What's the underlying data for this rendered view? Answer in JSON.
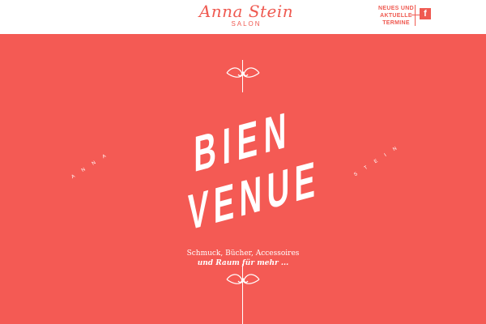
{
  "header": {
    "logo_script": "Anna Stein",
    "logo_sub": "SALON",
    "news_link": [
      "NEUES UND",
      "AKTUELLE",
      "TERMINE"
    ],
    "facebook_glyph": "f",
    "facebook_icon": "facebook-icon"
  },
  "hero": {
    "title_line1": "BIEN",
    "title_line2": "VENUE",
    "side_left": "ANNA",
    "side_right": "STEIN",
    "tagline_line1": "Schmuck, Bücher, Accessoires",
    "tagline_line2": "und Raum für mehr ..."
  },
  "colors": {
    "accent": "#f45a54",
    "header_bg": "#ffffff",
    "text_on_accent": "#ffffff"
  },
  "icons": {
    "ornament_top": "flourish-ornament-icon",
    "ornament_bottom": "flourish-ornament-icon"
  }
}
